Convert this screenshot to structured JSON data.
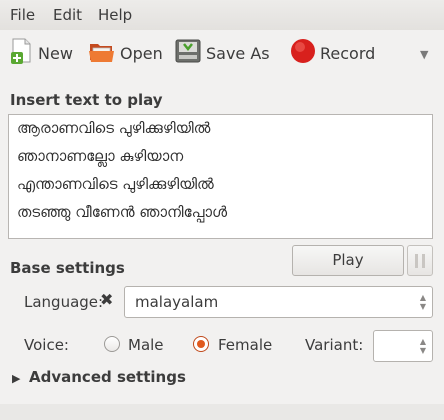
{
  "menu": {
    "file": "File",
    "edit": "Edit",
    "help": "Help"
  },
  "toolbar": {
    "new_label": "New",
    "open_label": "Open",
    "save_as_label": "Save As",
    "record_label": "Record",
    "overflow_icon": "▼"
  },
  "insert_section": {
    "title": "Insert text to play",
    "lines": [
      "ആരാണവിടെ പുഴിക്കുഴിയിൽ",
      "ഞാനാണല്ലോ കുഴിയാന",
      "എന്താണവിടെ പുഴിക്കുഴിയിൽ",
      "തടഞ്ഞു വീണേൻ ഞാനിപ്പോൾ"
    ]
  },
  "base_settings": {
    "title": "Base settings",
    "play_label": "Play",
    "language_label": "Language:",
    "language_value": "malayalam",
    "voice_label": "Voice:",
    "male_label": "Male",
    "female_label": "Female",
    "variant_label": "Variant:",
    "variant_value": ""
  },
  "advanced": {
    "title": "Advanced settings",
    "expanded": false
  },
  "icons": {
    "new": "new-document-icon",
    "open": "open-folder-icon",
    "save_as": "save-drive-icon",
    "record": "record-icon",
    "clear": "clear-x-icon"
  },
  "colors": {
    "record_red": "#d8201d",
    "radio_selected": "#e05a1f",
    "window_bg": "#f2f1f0"
  }
}
